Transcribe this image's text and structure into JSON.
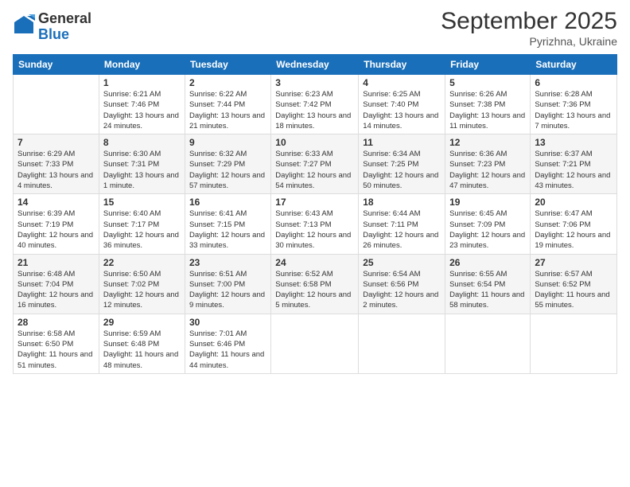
{
  "logo": {
    "general": "General",
    "blue": "Blue"
  },
  "title": "September 2025",
  "subtitle": "Pyrizhna, Ukraine",
  "days_of_week": [
    "Sunday",
    "Monday",
    "Tuesday",
    "Wednesday",
    "Thursday",
    "Friday",
    "Saturday"
  ],
  "weeks": [
    [
      {
        "day": "",
        "info": ""
      },
      {
        "day": "1",
        "info": "Sunrise: 6:21 AM\nSunset: 7:46 PM\nDaylight: 13 hours and 24 minutes."
      },
      {
        "day": "2",
        "info": "Sunrise: 6:22 AM\nSunset: 7:44 PM\nDaylight: 13 hours and 21 minutes."
      },
      {
        "day": "3",
        "info": "Sunrise: 6:23 AM\nSunset: 7:42 PM\nDaylight: 13 hours and 18 minutes."
      },
      {
        "day": "4",
        "info": "Sunrise: 6:25 AM\nSunset: 7:40 PM\nDaylight: 13 hours and 14 minutes."
      },
      {
        "day": "5",
        "info": "Sunrise: 6:26 AM\nSunset: 7:38 PM\nDaylight: 13 hours and 11 minutes."
      },
      {
        "day": "6",
        "info": "Sunrise: 6:28 AM\nSunset: 7:36 PM\nDaylight: 13 hours and 7 minutes."
      }
    ],
    [
      {
        "day": "7",
        "info": "Sunrise: 6:29 AM\nSunset: 7:33 PM\nDaylight: 13 hours and 4 minutes."
      },
      {
        "day": "8",
        "info": "Sunrise: 6:30 AM\nSunset: 7:31 PM\nDaylight: 13 hours and 1 minute."
      },
      {
        "day": "9",
        "info": "Sunrise: 6:32 AM\nSunset: 7:29 PM\nDaylight: 12 hours and 57 minutes."
      },
      {
        "day": "10",
        "info": "Sunrise: 6:33 AM\nSunset: 7:27 PM\nDaylight: 12 hours and 54 minutes."
      },
      {
        "day": "11",
        "info": "Sunrise: 6:34 AM\nSunset: 7:25 PM\nDaylight: 12 hours and 50 minutes."
      },
      {
        "day": "12",
        "info": "Sunrise: 6:36 AM\nSunset: 7:23 PM\nDaylight: 12 hours and 47 minutes."
      },
      {
        "day": "13",
        "info": "Sunrise: 6:37 AM\nSunset: 7:21 PM\nDaylight: 12 hours and 43 minutes."
      }
    ],
    [
      {
        "day": "14",
        "info": "Sunrise: 6:39 AM\nSunset: 7:19 PM\nDaylight: 12 hours and 40 minutes."
      },
      {
        "day": "15",
        "info": "Sunrise: 6:40 AM\nSunset: 7:17 PM\nDaylight: 12 hours and 36 minutes."
      },
      {
        "day": "16",
        "info": "Sunrise: 6:41 AM\nSunset: 7:15 PM\nDaylight: 12 hours and 33 minutes."
      },
      {
        "day": "17",
        "info": "Sunrise: 6:43 AM\nSunset: 7:13 PM\nDaylight: 12 hours and 30 minutes."
      },
      {
        "day": "18",
        "info": "Sunrise: 6:44 AM\nSunset: 7:11 PM\nDaylight: 12 hours and 26 minutes."
      },
      {
        "day": "19",
        "info": "Sunrise: 6:45 AM\nSunset: 7:09 PM\nDaylight: 12 hours and 23 minutes."
      },
      {
        "day": "20",
        "info": "Sunrise: 6:47 AM\nSunset: 7:06 PM\nDaylight: 12 hours and 19 minutes."
      }
    ],
    [
      {
        "day": "21",
        "info": "Sunrise: 6:48 AM\nSunset: 7:04 PM\nDaylight: 12 hours and 16 minutes."
      },
      {
        "day": "22",
        "info": "Sunrise: 6:50 AM\nSunset: 7:02 PM\nDaylight: 12 hours and 12 minutes."
      },
      {
        "day": "23",
        "info": "Sunrise: 6:51 AM\nSunset: 7:00 PM\nDaylight: 12 hours and 9 minutes."
      },
      {
        "day": "24",
        "info": "Sunrise: 6:52 AM\nSunset: 6:58 PM\nDaylight: 12 hours and 5 minutes."
      },
      {
        "day": "25",
        "info": "Sunrise: 6:54 AM\nSunset: 6:56 PM\nDaylight: 12 hours and 2 minutes."
      },
      {
        "day": "26",
        "info": "Sunrise: 6:55 AM\nSunset: 6:54 PM\nDaylight: 11 hours and 58 minutes."
      },
      {
        "day": "27",
        "info": "Sunrise: 6:57 AM\nSunset: 6:52 PM\nDaylight: 11 hours and 55 minutes."
      }
    ],
    [
      {
        "day": "28",
        "info": "Sunrise: 6:58 AM\nSunset: 6:50 PM\nDaylight: 11 hours and 51 minutes."
      },
      {
        "day": "29",
        "info": "Sunrise: 6:59 AM\nSunset: 6:48 PM\nDaylight: 11 hours and 48 minutes."
      },
      {
        "day": "30",
        "info": "Sunrise: 7:01 AM\nSunset: 6:46 PM\nDaylight: 11 hours and 44 minutes."
      },
      {
        "day": "",
        "info": ""
      },
      {
        "day": "",
        "info": ""
      },
      {
        "day": "",
        "info": ""
      },
      {
        "day": "",
        "info": ""
      }
    ]
  ]
}
